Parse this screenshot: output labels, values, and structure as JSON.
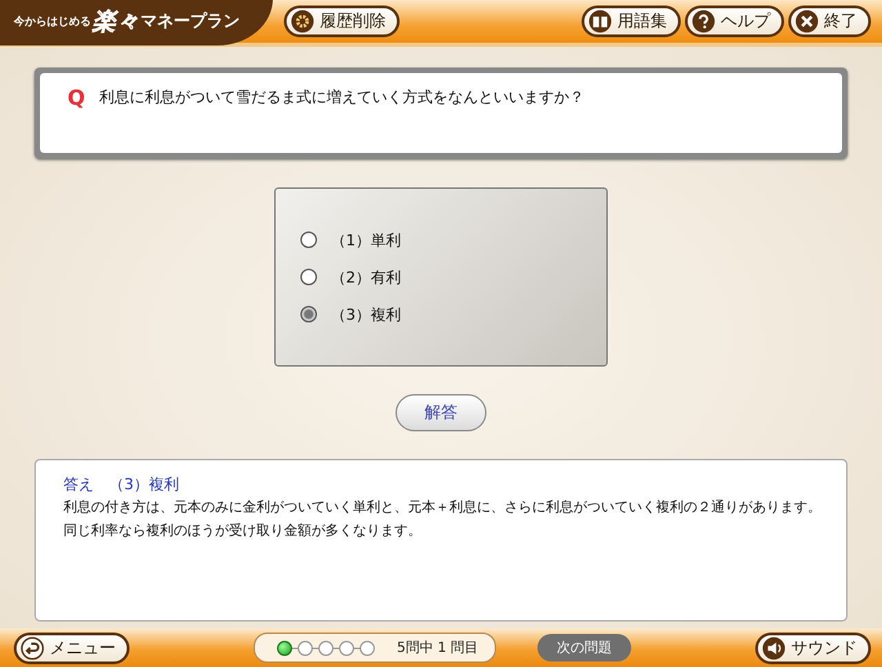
{
  "header": {
    "logo": {
      "prefix": "今からはじめる",
      "accent": "楽々",
      "suffix": "マネープラン"
    },
    "buttons": [
      {
        "kind": "history",
        "label": "履歴削除"
      },
      {
        "kind": "glossary",
        "label": "用語集"
      },
      {
        "kind": "help",
        "label": "ヘルプ"
      },
      {
        "kind": "exit",
        "label": "終了"
      }
    ]
  },
  "question": {
    "mark": "Q",
    "text": "利息に利息がついて雪だるま式に増えていく方式をなんといいますか？"
  },
  "options": [
    {
      "label": "（1）単利",
      "selected": false
    },
    {
      "label": "（2）有利",
      "selected": false
    },
    {
      "label": "（3）複利",
      "selected": true
    }
  ],
  "answer_button": "解答",
  "answer": {
    "title": "答え　（3）複利",
    "lines": [
      "利息の付き方は、元本のみに金利がついていく単利と、元本＋利息に、さらに利息がついていく複利の２通りがあります。",
      "同じ利率なら複利のほうが受け取り金額が多くなります。"
    ]
  },
  "footer": {
    "menu": "メニュー",
    "progress": [
      {
        "selected": true
      },
      {
        "selected": false
      },
      {
        "selected": false
      },
      {
        "selected": false
      },
      {
        "selected": false
      }
    ],
    "progress_text": "5問中 1 問目",
    "next": "次の問題",
    "sound": "サウンド"
  }
}
